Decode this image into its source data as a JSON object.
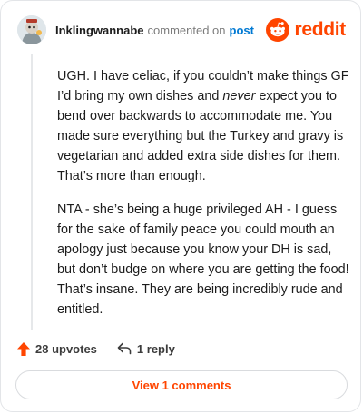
{
  "comment": {
    "username": "Inklingwannabe",
    "commented_text": "commented on",
    "post_link": "post",
    "brand": "reddit",
    "body_part1": "UGH. I have celiac, if you couldn’t make things GF I’d bring my own dishes and ",
    "body_emphasis": "never",
    "body_part2": " expect you to bend over backwards to accommodate me. You made sure everything but the Turkey and gravy is vegetarian and added extra side dishes for them. That’s more than enough.",
    "body_paragraph2": "NTA - she’s being a huge privileged AH - I guess for the sake of family peace you could mouth an apology just because you know your DH is sad, but don’t budge on where you are getting the food! That’s insane. They are being incredibly rude and entitled."
  },
  "actions": {
    "upvotes_label": "28 upvotes",
    "reply_label": "1 reply",
    "view_comments_label": "View 1 comments"
  },
  "colors": {
    "accent": "#ff4500",
    "link": "#0079d3"
  },
  "icons": [
    "avatar-icon",
    "reddit-logo-icon",
    "upvote-arrow-icon",
    "reply-arrow-icon"
  ]
}
